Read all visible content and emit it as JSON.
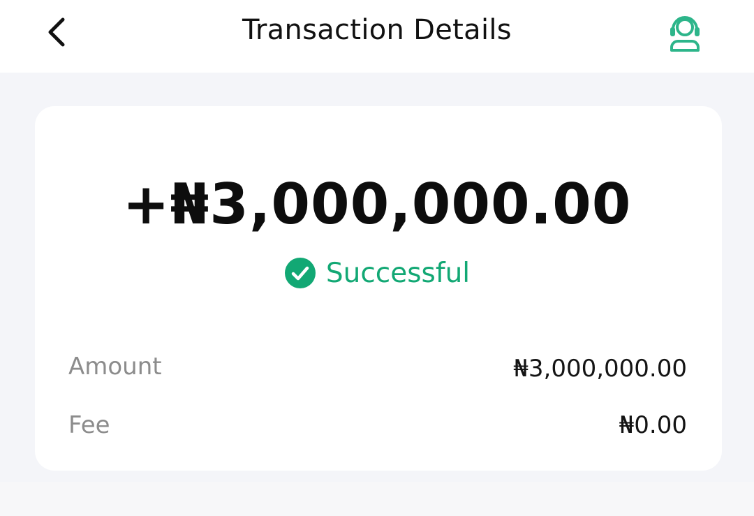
{
  "header": {
    "title": "Transaction Details",
    "back_icon": "chevron-left-icon",
    "support_icon": "customer-support-headset-icon"
  },
  "transaction": {
    "amount_display": "+₦3,000,000.00",
    "status": {
      "label": "Successful",
      "icon": "check-circle-icon",
      "color": "#12a874"
    },
    "details": [
      {
        "label": "Amount",
        "value": "₦3,000,000.00"
      },
      {
        "label": "Fee",
        "value": "₦0.00"
      }
    ]
  },
  "colors": {
    "accent": "#12a874",
    "page_background": "#f4f5f9",
    "card_background": "#ffffff"
  }
}
